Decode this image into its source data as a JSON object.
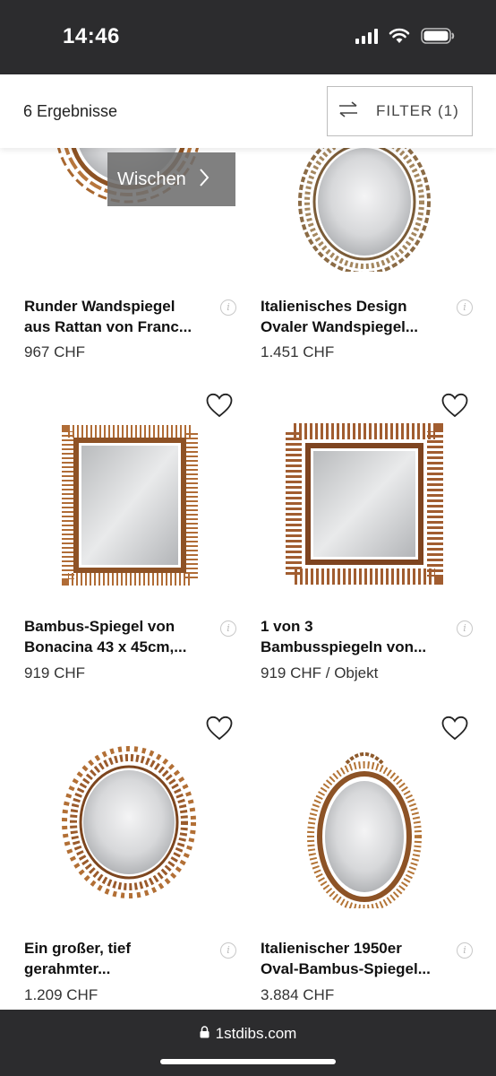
{
  "status_bar": {
    "time": "14:46"
  },
  "results": {
    "count_label": "6 Ergebnisse",
    "filter_label": "FILTER (1)"
  },
  "tooltip": {
    "label": "Wischen"
  },
  "products": [
    {
      "title_line1": "Runder Wandspiegel",
      "title_line2": "aus Rattan von Franc...",
      "price": "967 CHF"
    },
    {
      "title_line1": "Italienisches Design",
      "title_line2": "Ovaler Wandspiegel...",
      "price": "1.451 CHF"
    },
    {
      "title_line1": "Bambus-Spiegel von",
      "title_line2": "Bonacina 43 x 45cm,...",
      "price": "919 CHF"
    },
    {
      "title_line1": "1 von 3",
      "title_line2": "Bambusspiegeln von...",
      "price": "919 CHF / Objekt"
    },
    {
      "title_line1": "Ein großer, tief",
      "title_line2": "gerahmter...",
      "price": "1.209 CHF"
    },
    {
      "title_line1": "Italienischer 1950er",
      "title_line2": "Oval-Bambus-Spiegel...",
      "price": "3.884 CHF"
    }
  ],
  "browser": {
    "url": "1stdibs.com"
  },
  "icons": {
    "filter": "sliders-icon",
    "heart": "heart-outline-icon",
    "info": "info-icon",
    "lock": "lock-icon",
    "chevron": "chevron-right-icon"
  },
  "colors": {
    "system_bar": "#2c2c2e",
    "text": "#111111",
    "rattan": "#b06c36",
    "mirror": "#d9dadc"
  }
}
